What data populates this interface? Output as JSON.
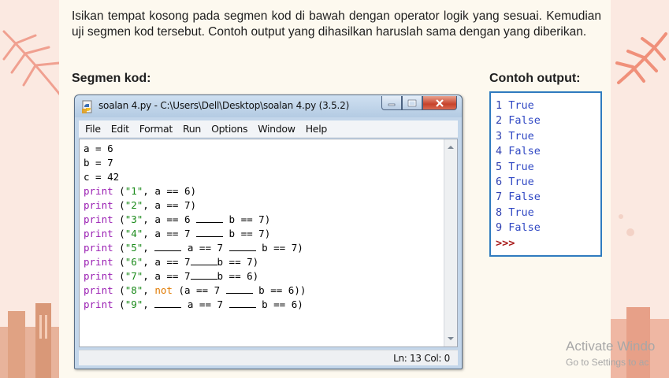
{
  "instruction": "Isikan tempat kosong pada segmen kod di bawah dengan operator logik yang sesuai. Kemudian uji segmen kod tersebut. Contoh output yang dihasilkan haruslah sama dengan yang diberikan.",
  "headings": {
    "code": "Segmen kod:",
    "output": "Contoh output:"
  },
  "window": {
    "title": "soalan 4.py - C:\\Users\\Dell\\Desktop\\soalan 4.py (3.5.2)",
    "menu": [
      "File",
      "Edit",
      "Format",
      "Run",
      "Options",
      "Window",
      "Help"
    ],
    "status": "Ln: 13   Col: 0"
  },
  "code_lines": [
    [
      {
        "t": "a = 6"
      }
    ],
    [
      {
        "t": "b = 7"
      }
    ],
    [
      {
        "t": "c = 42"
      }
    ],
    [
      {
        "t": "print",
        "c": "kw"
      },
      {
        "t": " ("
      },
      {
        "t": "\"1\"",
        "c": "str"
      },
      {
        "t": ", a == 6)"
      }
    ],
    [
      {
        "t": "print",
        "c": "kw"
      },
      {
        "t": " ("
      },
      {
        "t": "\"2\"",
        "c": "str"
      },
      {
        "t": ", a == 7)"
      }
    ],
    [
      {
        "t": "print",
        "c": "kw"
      },
      {
        "t": " ("
      },
      {
        "t": "\"3\"",
        "c": "str"
      },
      {
        "t": ", a == 6 "
      },
      {
        "blank": 1
      },
      {
        "t": " b == 7)"
      }
    ],
    [
      {
        "t": "print",
        "c": "kw"
      },
      {
        "t": " ("
      },
      {
        "t": "\"4\"",
        "c": "str"
      },
      {
        "t": ", a == 7 "
      },
      {
        "blank": 1
      },
      {
        "t": " b == 7)"
      }
    ],
    [
      {
        "t": "print",
        "c": "kw"
      },
      {
        "t": " ("
      },
      {
        "t": "\"5\"",
        "c": "str"
      },
      {
        "t": ", "
      },
      {
        "blank": 1
      },
      {
        "t": " a == 7 "
      },
      {
        "blank": 1
      },
      {
        "t": " b == 7)"
      }
    ],
    [
      {
        "t": "print",
        "c": "kw"
      },
      {
        "t": " ("
      },
      {
        "t": "\"6\"",
        "c": "str"
      },
      {
        "t": ", a == 7"
      },
      {
        "blank": 1
      },
      {
        "t": "b == 7)"
      }
    ],
    [
      {
        "t": "print",
        "c": "kw"
      },
      {
        "t": " ("
      },
      {
        "t": "\"7\"",
        "c": "str"
      },
      {
        "t": ", a == 7"
      },
      {
        "blank": 1
      },
      {
        "t": "b == 6)"
      }
    ],
    [
      {
        "t": "print",
        "c": "kw"
      },
      {
        "t": " ("
      },
      {
        "t": "\"8\"",
        "c": "str"
      },
      {
        "t": ", "
      },
      {
        "t": "not",
        "c": "op"
      },
      {
        "t": " (a == 7 "
      },
      {
        "blank": 1
      },
      {
        "t": " b == 6))"
      }
    ],
    [
      {
        "t": "print",
        "c": "kw"
      },
      {
        "t": " ("
      },
      {
        "t": "\"9\"",
        "c": "str"
      },
      {
        "t": ", "
      },
      {
        "blank": 1
      },
      {
        "t": " a == 7 "
      },
      {
        "blank": 1
      },
      {
        "t": " b == 6)"
      }
    ]
  ],
  "output_lines": [
    {
      "n": "1",
      "v": "True"
    },
    {
      "n": "2",
      "v": "False"
    },
    {
      "n": "3",
      "v": "True"
    },
    {
      "n": "4",
      "v": "False"
    },
    {
      "n": "5",
      "v": "True"
    },
    {
      "n": "6",
      "v": "True"
    },
    {
      "n": "7",
      "v": "False"
    },
    {
      "n": "8",
      "v": "True"
    },
    {
      "n": "9",
      "v": "False"
    }
  ],
  "output_prompt": ">>>",
  "watermark": {
    "line1": "Activate Windo",
    "line2": "Go to Settings to ac"
  },
  "colors": {
    "keyword": "#9a1fb3",
    "string": "#1a8a1a",
    "not_keyword": "#e07a00",
    "output_border": "#2f7bbf",
    "prompt": "#a81b1b"
  }
}
